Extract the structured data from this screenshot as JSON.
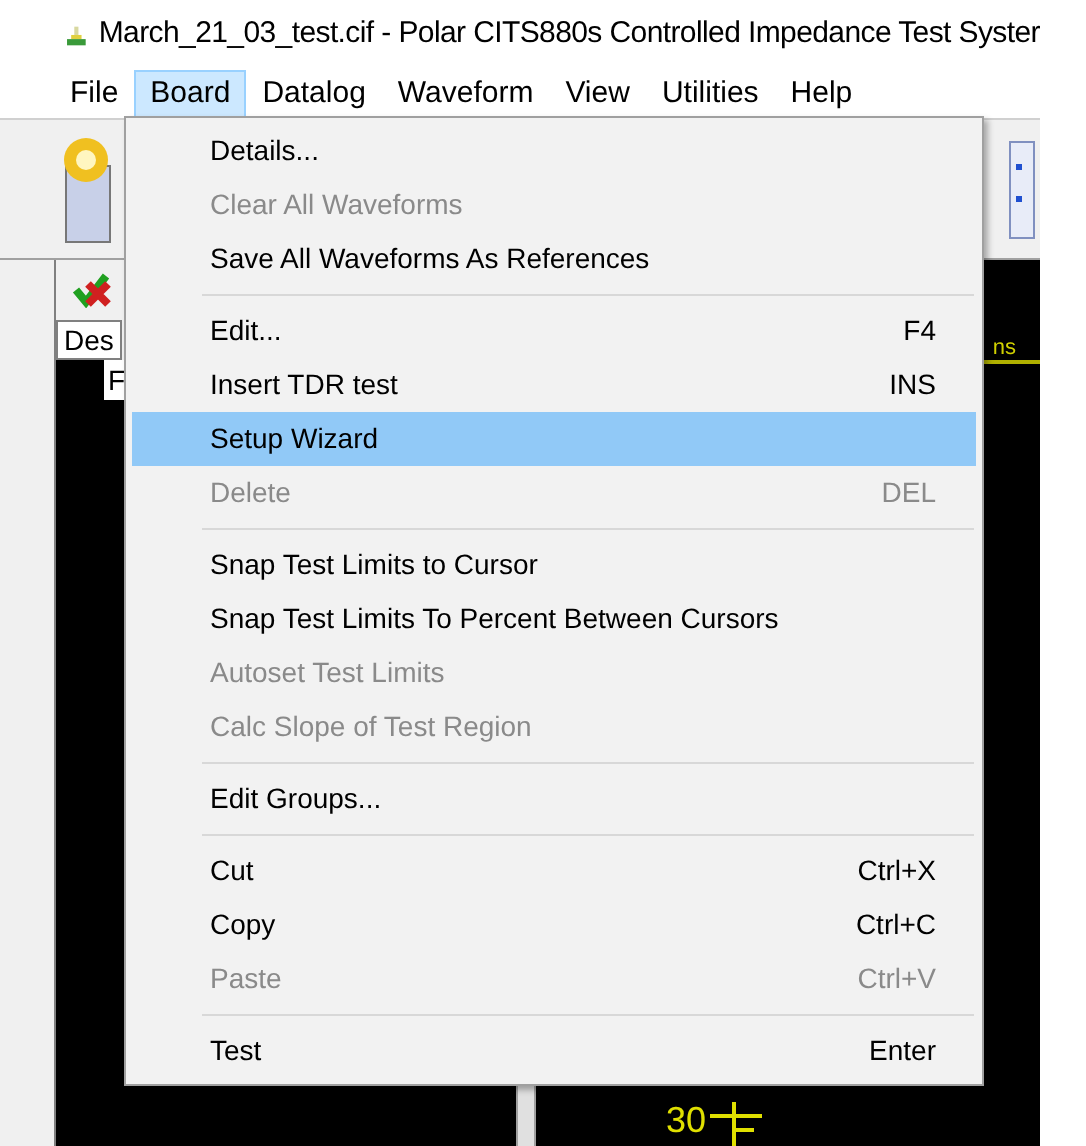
{
  "window": {
    "title": "March_21_03_test.cif - Polar CITS880s Controlled Impedance Test Syster"
  },
  "menu_bar": [
    {
      "label": "File",
      "selected": false
    },
    {
      "label": "Board",
      "selected": true
    },
    {
      "label": "Datalog",
      "selected": false
    },
    {
      "label": "Waveform",
      "selected": false
    },
    {
      "label": "View",
      "selected": false
    },
    {
      "label": "Utilities",
      "selected": false
    },
    {
      "label": "Help",
      "selected": false
    }
  ],
  "board_menu": [
    {
      "kind": "item",
      "label": "Details...",
      "disabled": false,
      "selected": false
    },
    {
      "kind": "item",
      "label": "Clear All Waveforms",
      "disabled": true,
      "selected": false
    },
    {
      "kind": "item",
      "label": "Save All Waveforms As References",
      "disabled": false,
      "selected": false
    },
    {
      "kind": "separator"
    },
    {
      "kind": "item",
      "label": "Edit...",
      "shortcut": "F4",
      "disabled": false,
      "selected": false
    },
    {
      "kind": "item",
      "label": "Insert TDR test",
      "shortcut": "INS",
      "disabled": false,
      "selected": false
    },
    {
      "kind": "item",
      "label": "Setup Wizard",
      "disabled": false,
      "selected": true
    },
    {
      "kind": "item",
      "label": "Delete",
      "shortcut": "DEL",
      "disabled": true,
      "selected": false
    },
    {
      "kind": "separator"
    },
    {
      "kind": "item",
      "label": "Snap Test Limits to Cursor",
      "disabled": false,
      "selected": false
    },
    {
      "kind": "item",
      "label": "Snap Test Limits To Percent Between Cursors",
      "disabled": false,
      "selected": false
    },
    {
      "kind": "item",
      "label": "Autoset Test Limits",
      "disabled": true,
      "selected": false
    },
    {
      "kind": "item",
      "label": "Calc Slope of Test Region",
      "disabled": true,
      "selected": false
    },
    {
      "kind": "separator"
    },
    {
      "kind": "item",
      "label": "Edit Groups...",
      "disabled": false,
      "selected": false
    },
    {
      "kind": "separator"
    },
    {
      "kind": "item",
      "label": "Cut",
      "shortcut": "Ctrl+X",
      "disabled": false,
      "selected": false
    },
    {
      "kind": "item",
      "label": "Copy",
      "shortcut": "Ctrl+C",
      "disabled": false,
      "selected": false
    },
    {
      "kind": "item",
      "label": "Paste",
      "shortcut": "Ctrl+V",
      "disabled": true,
      "selected": false
    },
    {
      "kind": "separator"
    },
    {
      "kind": "item",
      "label": "Test",
      "shortcut": "Enter",
      "disabled": false,
      "selected": false
    }
  ],
  "test_list": {
    "column_1": "Des",
    "row_1": "F"
  },
  "waveform": {
    "axis_unit": "ns",
    "y_label": "30"
  }
}
